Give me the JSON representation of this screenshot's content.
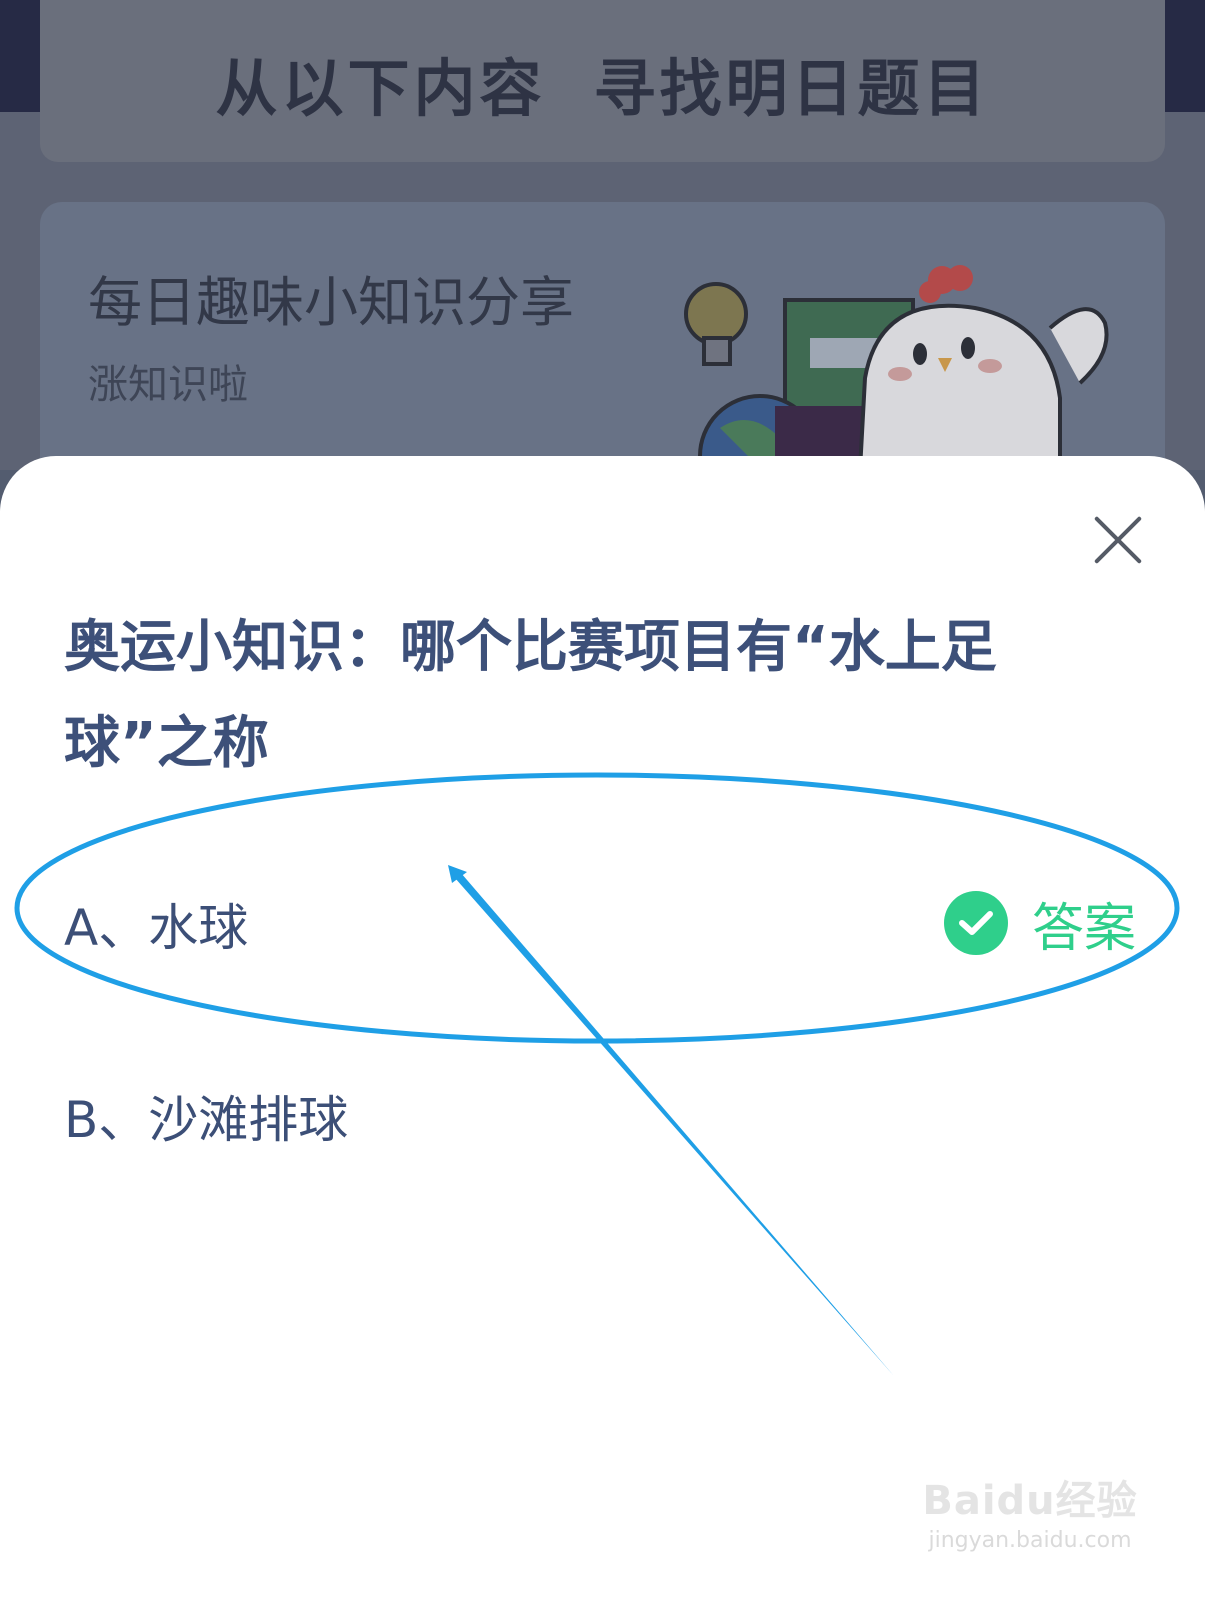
{
  "background": {
    "header_title_left": "从以下内容",
    "header_title_right": "寻找明日题目",
    "card_title": "每日趣味小知识分享",
    "card_subtitle": "涨知识啦"
  },
  "sheet": {
    "question": "奥运小知识：哪个比赛项目有“水上足球”之称",
    "options": [
      {
        "label": "A、水球"
      },
      {
        "label": "B、沙滩排球"
      }
    ],
    "answer_label": "答案"
  },
  "colors": {
    "question_text": "#3d5079",
    "answer_green": "#2fcf8b",
    "annotation_blue": "#1f9fe6",
    "overlay_dim": "#5d6374"
  },
  "icons": [
    "close-icon",
    "check-circle-icon",
    "chick-mascot",
    "lightbulb-icon"
  ],
  "watermark": {
    "logo": "Baidu经验",
    "url": "jingyan.baidu.com"
  }
}
